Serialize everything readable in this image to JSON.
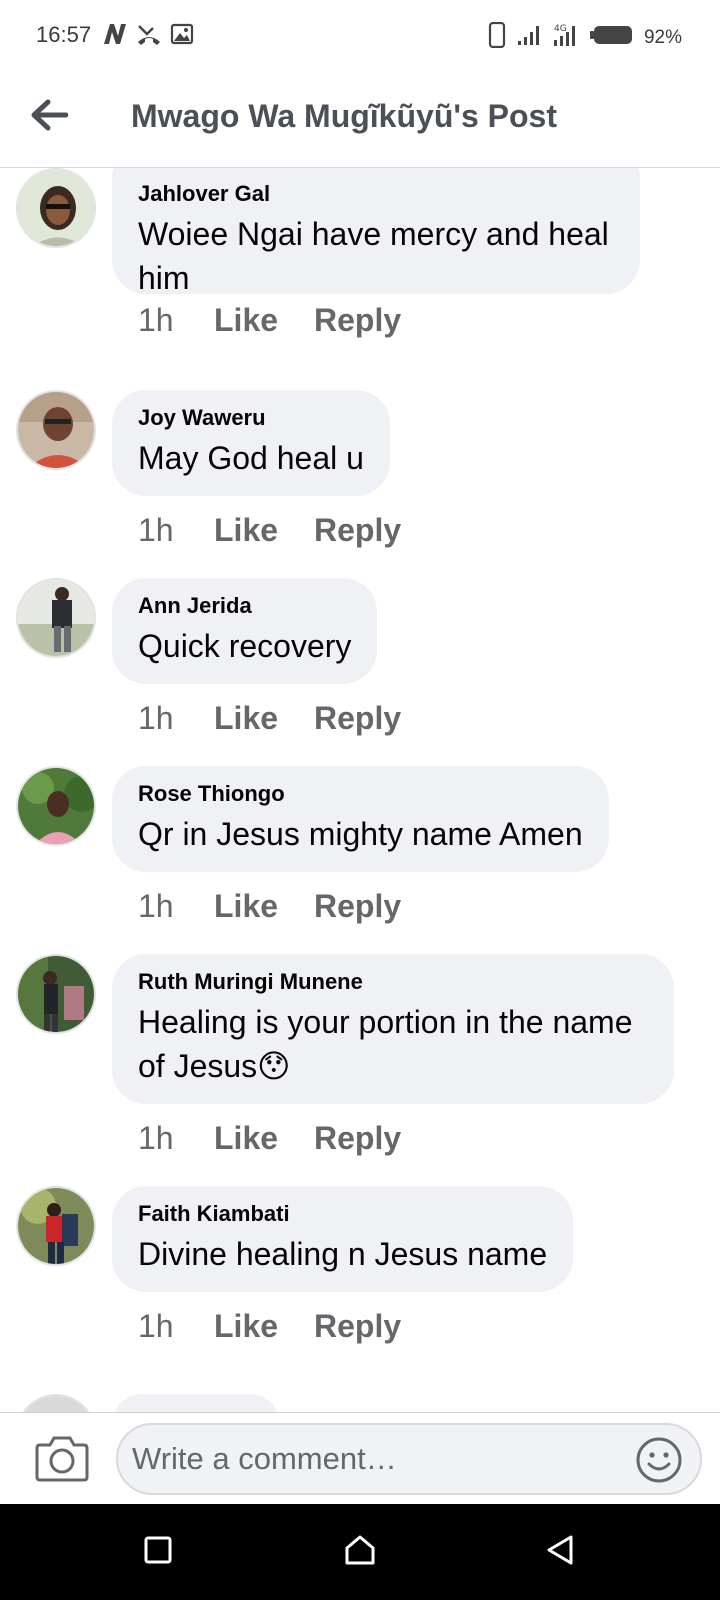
{
  "status_bar": {
    "time": "16:57",
    "battery_percent": "92%",
    "left_icons": [
      "network-n-icon",
      "missed-call-icon",
      "gallery-icon"
    ],
    "right_icons": [
      "vibrate-icon",
      "signal-icon",
      "signal-data-icon",
      "battery-icon"
    ]
  },
  "header": {
    "title": "Mwago Wa Mugĩkũyũ's Post",
    "back_icon": "back-arrow-icon"
  },
  "comments": [
    {
      "author": "Jahlover Gal",
      "text": "Woiee Ngai have mercy and heal him",
      "time": "1h",
      "like": "Like",
      "reply": "Reply"
    },
    {
      "author": "Joy Waweru",
      "text": "May God heal u",
      "time": "1h",
      "like": "Like",
      "reply": "Reply"
    },
    {
      "author": "Ann Jerida",
      "text": "Quick recovery",
      "time": "1h",
      "like": "Like",
      "reply": "Reply"
    },
    {
      "author": "Rose Thiongo",
      "text": "Qr in Jesus mighty name Amen",
      "time": "1h",
      "like": "Like",
      "reply": "Reply"
    },
    {
      "author": "Ruth Muringi Munene",
      "text": "Healing is your portion in the name of Jesus😯",
      "time": "1h",
      "like": "Like",
      "reply": "Reply"
    },
    {
      "author": "Faith Kiambati",
      "text": "Divine healing n Jesus name",
      "time": "1h",
      "like": "Like",
      "reply": "Reply"
    }
  ],
  "composer": {
    "placeholder": "Write a comment…",
    "camera_icon": "camera-icon",
    "emoji_icon": "emoji-icon"
  },
  "navbar": {
    "icons": [
      "recent-apps-icon",
      "home-icon",
      "back-icon"
    ]
  },
  "colors": {
    "bubble": "#f0f1f4",
    "secondary_text": "#65676b",
    "header_title": "#4b4f56"
  }
}
